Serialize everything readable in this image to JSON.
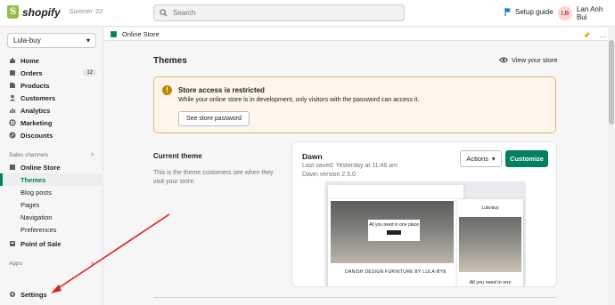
{
  "topbar": {
    "brand": "shopify",
    "edition": "Summer '22",
    "search_placeholder": "Search",
    "setup_guide": "Setup guide",
    "user_initials": "LB",
    "user_name": "Lan Anh Bui"
  },
  "sidebar": {
    "store_name": "Lula-buy",
    "items": [
      {
        "label": "Home",
        "icon": "home-icon"
      },
      {
        "label": "Orders",
        "icon": "orders-icon",
        "badge": "12"
      },
      {
        "label": "Products",
        "icon": "products-icon"
      },
      {
        "label": "Customers",
        "icon": "customers-icon"
      },
      {
        "label": "Analytics",
        "icon": "analytics-icon"
      },
      {
        "label": "Marketing",
        "icon": "marketing-icon"
      },
      {
        "label": "Discounts",
        "icon": "discounts-icon"
      }
    ],
    "sales_channels_label": "Sales channels",
    "online_store": "Online Store",
    "sub_items": [
      "Themes",
      "Blog posts",
      "Pages",
      "Navigation",
      "Preferences"
    ],
    "point_of_sale": "Point of Sale",
    "apps_label": "Apps",
    "settings": "Settings"
  },
  "main": {
    "breadcrumb": "Online Store",
    "title": "Themes",
    "view_store": "View your store",
    "banner": {
      "title": "Store access is restricted",
      "text": "While your online store is in development, only visitors with the password can access it.",
      "button": "See store password"
    },
    "current_theme": {
      "heading": "Current theme",
      "description": "This is the theme customers see when they visit your store."
    },
    "theme_card": {
      "name": "Dawn",
      "last_saved": "Last saved: Yesterday at 11:46 am",
      "version": "Dawn version 2.5.0",
      "actions": "Actions",
      "customize": "Customize",
      "preview_desktop_text": "All you need in one place",
      "preview_caption": "DANISH DESIGN FURNITURE BY LULA-BYE",
      "preview_mobile_text": "All you need in one",
      "preview_store_name": "Lula-buy"
    }
  },
  "colors": {
    "accent": "#008060",
    "warning_bg": "#fff5ea",
    "annotation_arrow": "#e02020"
  }
}
